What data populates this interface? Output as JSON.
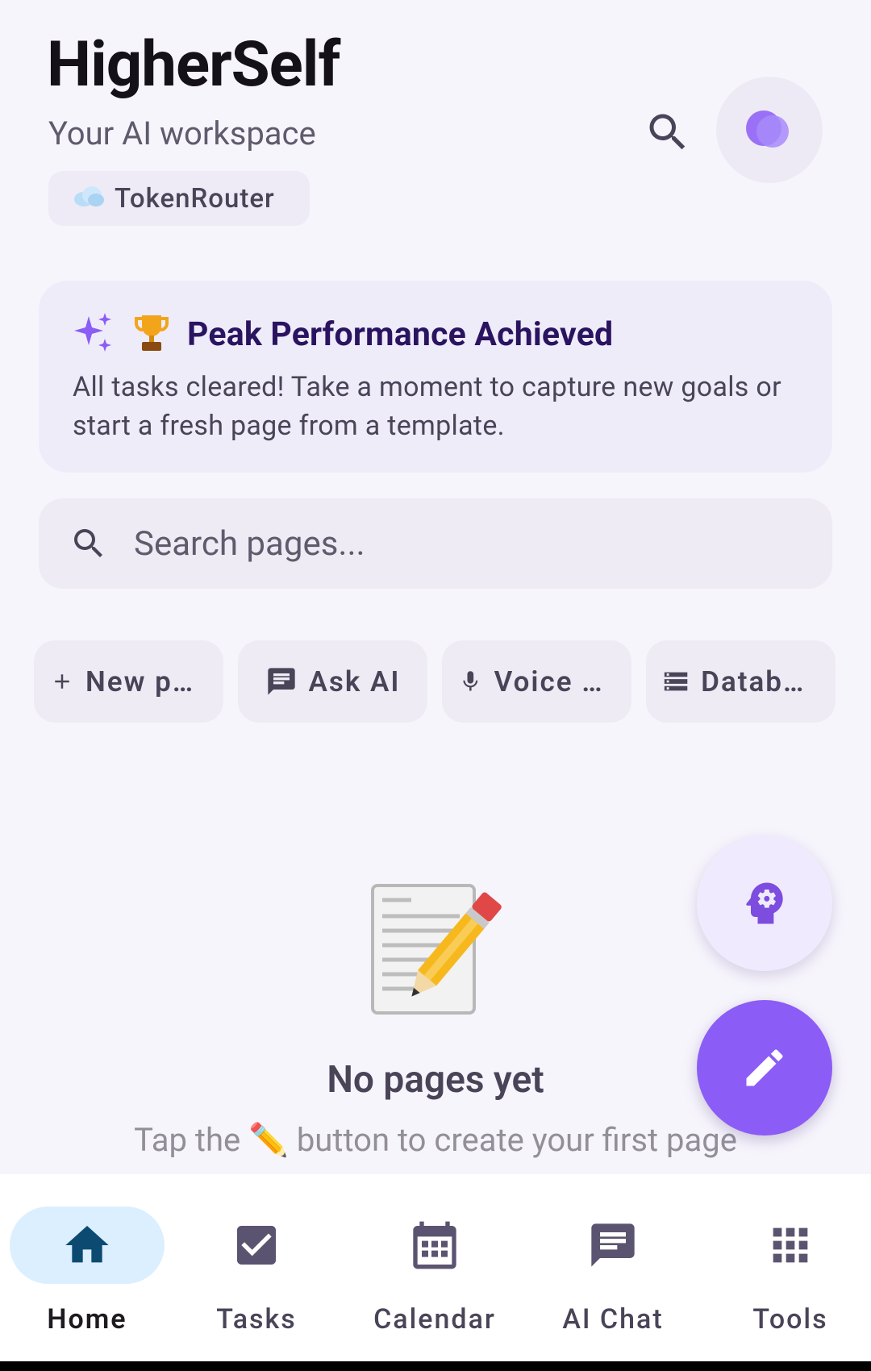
{
  "header": {
    "title": "HigherSelf",
    "subtitle": "Your AI workspace",
    "provider_chip": {
      "icon": "cloud-icon",
      "label": "TokenRouter"
    }
  },
  "banner": {
    "title": "Peak Performance Achieved",
    "message": "All tasks cleared! Take a moment to capture new goals or start a fresh page from a template."
  },
  "search": {
    "placeholder": "Search pages..."
  },
  "quick_actions": [
    {
      "icon": "plus-icon",
      "label": "New page"
    },
    {
      "icon": "chat-icon",
      "label": "Ask AI"
    },
    {
      "icon": "mic-icon",
      "label": "Voice note"
    },
    {
      "icon": "database-icon",
      "label": "Database"
    }
  ],
  "empty_state": {
    "title": "No pages yet",
    "subtitle": "Tap the ✏️ button to create your first page"
  },
  "bottom_nav": [
    {
      "label": "Home",
      "icon": "home-icon",
      "active": true
    },
    {
      "label": "Tasks",
      "icon": "checkbox-icon",
      "active": false
    },
    {
      "label": "Calendar",
      "icon": "calendar-icon",
      "active": false
    },
    {
      "label": "AI Chat",
      "icon": "chat-icon",
      "active": false
    },
    {
      "label": "Tools",
      "icon": "apps-grid-icon",
      "active": false
    }
  ],
  "colors": {
    "accent": "#8b5cf6",
    "background": "#f7f5fc",
    "banner_title": "#2a1460",
    "nav_active": "#dcefff"
  }
}
